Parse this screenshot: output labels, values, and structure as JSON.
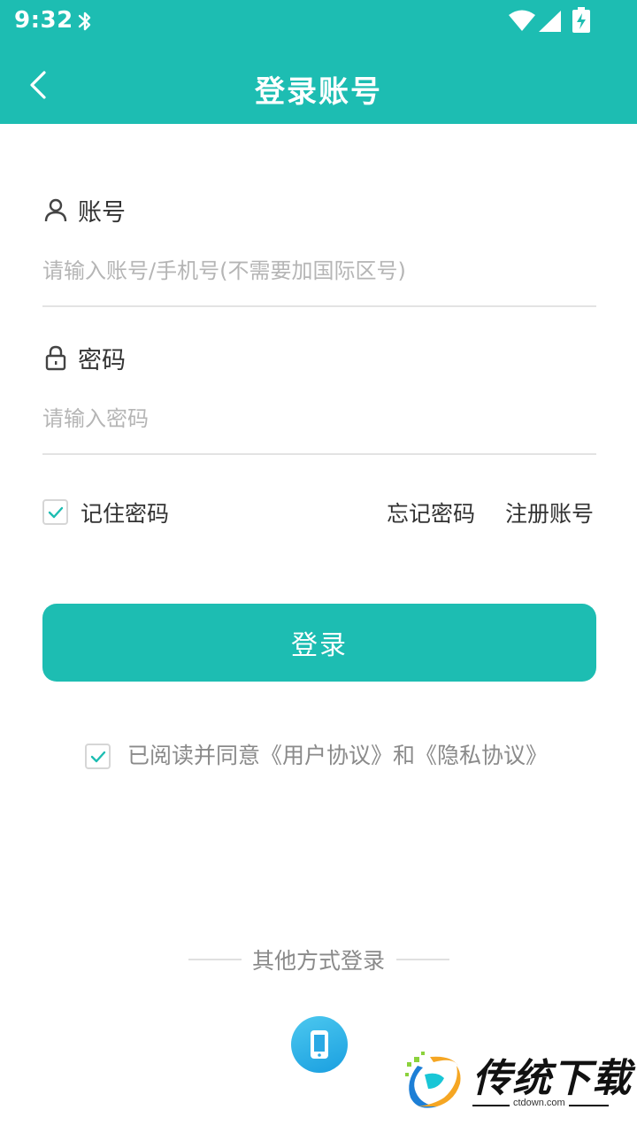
{
  "status_bar": {
    "time": "9:32"
  },
  "app_bar": {
    "title": "登录账号"
  },
  "account_field": {
    "label": "账号",
    "placeholder": "请输入账号/手机号(不需要加国际区号)"
  },
  "password_field": {
    "label": "密码",
    "placeholder": "请输入密码"
  },
  "options": {
    "remember_label": "记住密码",
    "remember_checked": true,
    "forgot_label": "忘记密码",
    "register_label": "注册账号"
  },
  "login_button": {
    "label": "登录"
  },
  "agreement": {
    "checked": true,
    "prefix": "已阅读并同意",
    "user_agreement": "《用户协议》",
    "joiner": "和",
    "privacy_agreement": "《隐私协议》"
  },
  "other_login": {
    "label": "其他方式登录",
    "methods": [
      {
        "icon": "phone-icon"
      }
    ]
  },
  "watermark": {
    "name": "传统下载",
    "url": "ctdown.com"
  },
  "colors": {
    "accent": "#1dbdb2",
    "placeholder": "#b5b5b5",
    "secondary_text": "#8a8a8a"
  }
}
